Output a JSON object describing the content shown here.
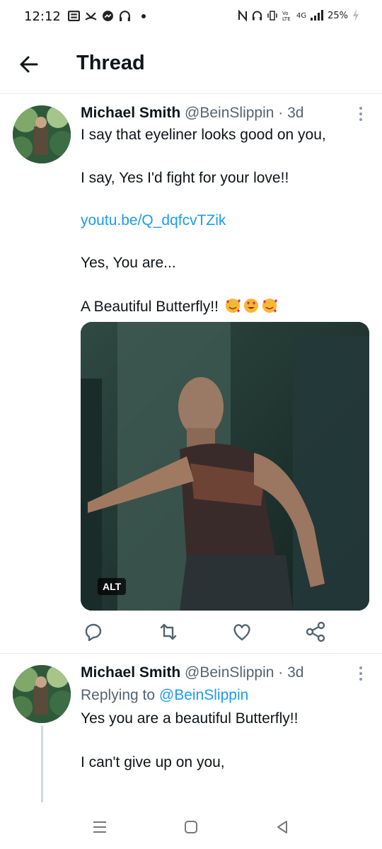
{
  "status_bar": {
    "time": "12:12",
    "battery": "25%",
    "network": "4G"
  },
  "header": {
    "title": "Thread"
  },
  "tweet1": {
    "name": "Michael Smith",
    "handle": "@BeinSlippin",
    "separator": "·",
    "time": "3d",
    "line1": "I say that eyeliner looks good on you,",
    "line2": "I say, Yes I'd fight for your love!!",
    "link": "youtu.be/Q_dqfcvTZik",
    "line3": "Yes, You are...",
    "line4": "A Beautiful Butterfly!!",
    "emojis": [
      "smiling-face-with-hearts-icon",
      "heart-eyes-icon",
      "smiling-face-with-hearts-icon"
    ],
    "media_alt_badge": "ALT"
  },
  "tweet2": {
    "name": "Michael Smith",
    "handle": "@BeinSlippin",
    "separator": "·",
    "time": "3d",
    "replying_prefix": "Replying to",
    "replying_handle": "@BeinSlippin",
    "line1": "Yes you are a beautiful Butterfly!!",
    "line2": "I can't give up on you,"
  },
  "colors": {
    "accent": "#1d9bf0",
    "text": "#0f1419",
    "muted": "#536471",
    "divider": "#e6ecf0"
  }
}
